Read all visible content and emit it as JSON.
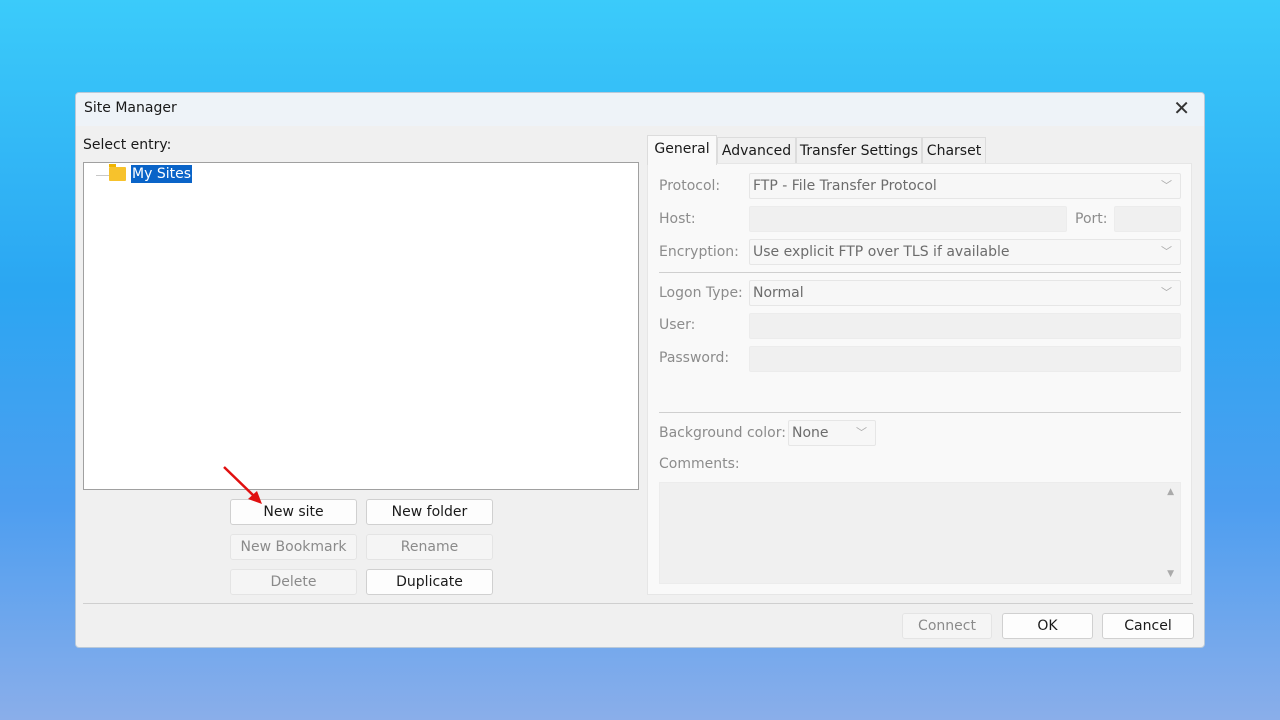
{
  "window": {
    "title": "Site Manager",
    "close_icon": "close-icon"
  },
  "left": {
    "select_label": "Select entry:",
    "tree": [
      {
        "label": "My Sites",
        "icon": "folder-icon",
        "selected": true
      }
    ]
  },
  "buttons": {
    "new_site": "New site",
    "new_folder": "New folder",
    "new_bookmark": "New Bookmark",
    "rename": "Rename",
    "delete": "Delete",
    "duplicate": "Duplicate"
  },
  "tabs": [
    {
      "label": "General",
      "active": true
    },
    {
      "label": "Advanced"
    },
    {
      "label": "Transfer Settings"
    },
    {
      "label": "Charset"
    }
  ],
  "general": {
    "protocol_label": "Protocol:",
    "protocol_value": "FTP - File Transfer Protocol",
    "host_label": "Host:",
    "host_value": "",
    "port_label": "Port:",
    "port_value": "",
    "encryption_label": "Encryption:",
    "encryption_value": "Use explicit FTP over TLS if available",
    "logon_label": "Logon Type:",
    "logon_value": "Normal",
    "user_label": "User:",
    "user_value": "",
    "password_label": "Password:",
    "password_value": "",
    "bgcolor_label": "Background color:",
    "bgcolor_value": "None",
    "comments_label": "Comments:",
    "comments_value": ""
  },
  "footer": {
    "connect": "Connect",
    "ok": "OK",
    "cancel": "Cancel"
  },
  "annotation": {
    "arrow_color": "#e01010",
    "points_to": "new-site-button"
  }
}
